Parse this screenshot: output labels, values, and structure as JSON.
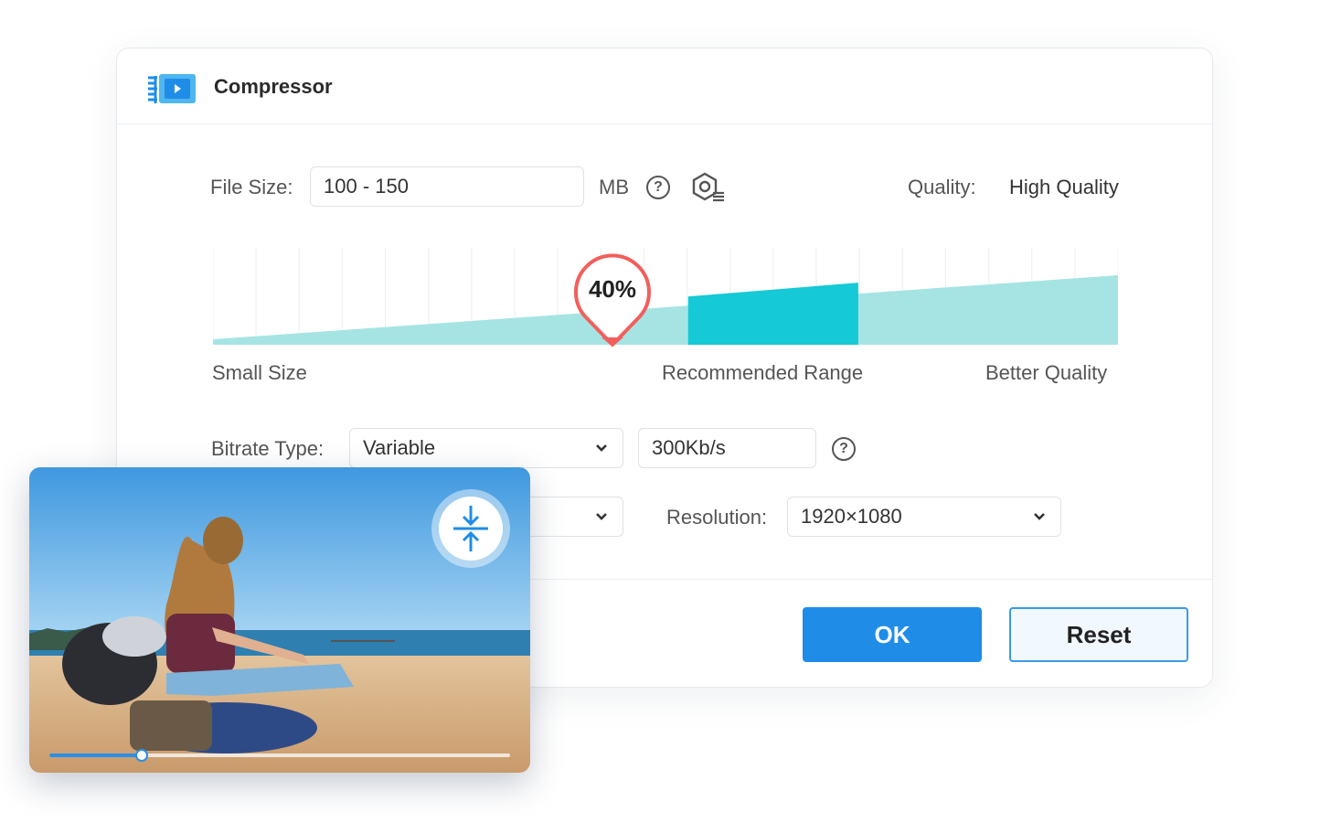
{
  "dialog": {
    "title": "Compressor",
    "icon": "video-compress-icon"
  },
  "file_size": {
    "label": "File Size:",
    "value": "100 - 150",
    "unit": "MB"
  },
  "quality": {
    "label": "Quality:",
    "value": "High Quality"
  },
  "compression_slider": {
    "value_label": "40%",
    "value": 0.4,
    "labels": {
      "left": "Small Size",
      "middle": "Recommended Range",
      "right": "Better Quality"
    },
    "recommended_range": [
      0.525,
      0.713
    ],
    "colors": {
      "ramp": "#a6e4e4",
      "recommended": "#15c9d6",
      "marker": "#f25f5c"
    }
  },
  "bitrate": {
    "label": "Bitrate Type:",
    "type_value": "Variable",
    "rate_value": "300Kb/s"
  },
  "resolution": {
    "label": "Resolution:",
    "value": "1920×1080"
  },
  "buttons": {
    "ok": "OK",
    "reset": "Reset"
  },
  "preview": {
    "progress": 0.2,
    "compress_icon": "compress-arrows-icon"
  },
  "colors": {
    "accent": "#1f8de8"
  }
}
